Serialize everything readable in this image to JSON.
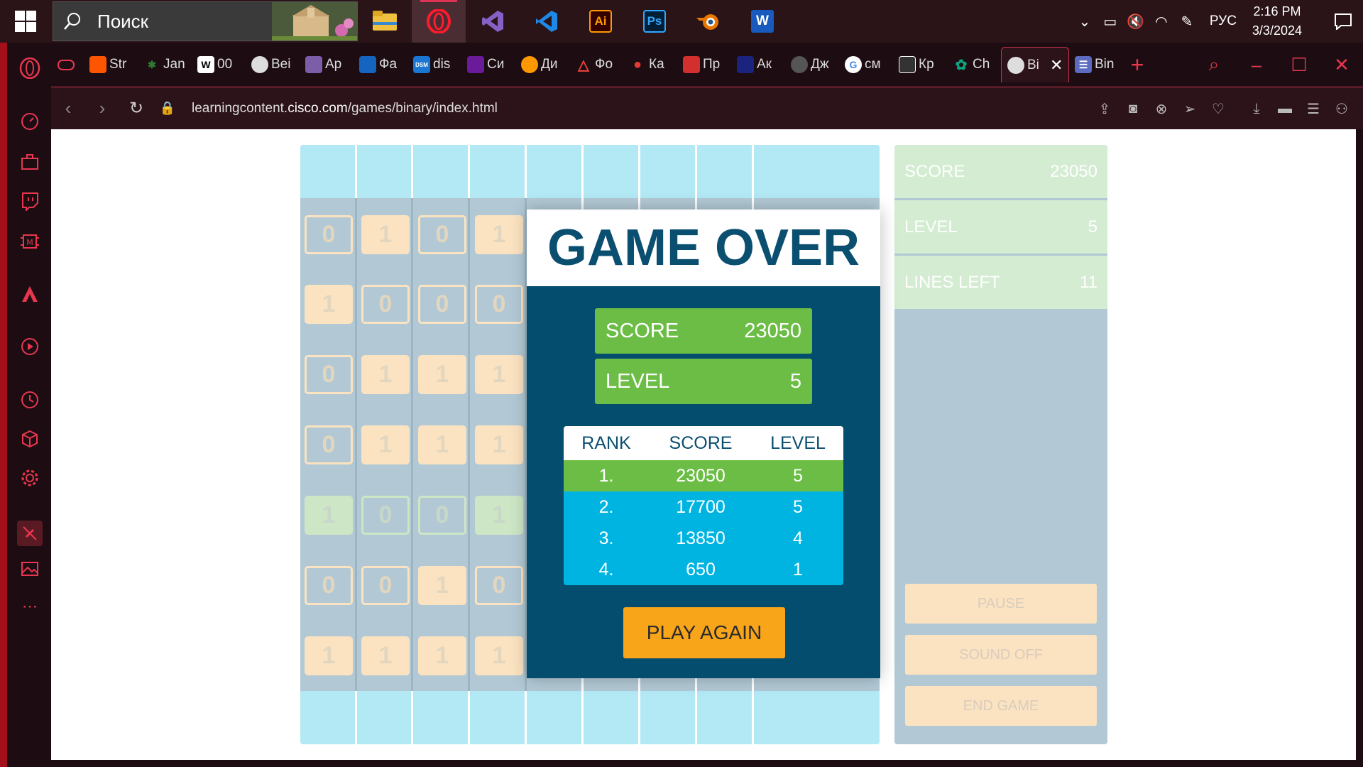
{
  "taskbar": {
    "search_placeholder": "Поиск",
    "apps": [
      "file-explorer",
      "opera",
      "visual-studio",
      "vscode",
      "illustrator",
      "photoshop",
      "blender",
      "word"
    ],
    "language": "РУС",
    "time": "2:16 PM",
    "date": "3/3/2024"
  },
  "tabs": [
    {
      "label": "Str",
      "color": "#ff5500"
    },
    {
      "label": "Jan",
      "color": "#2e7d32"
    },
    {
      "label": "00",
      "color": "#ffffff"
    },
    {
      "label": "Bei",
      "color": "#ffffff"
    },
    {
      "label": "Ap",
      "color": "#7b5ea7"
    },
    {
      "label": "Фа",
      "color": "#1565c0"
    },
    {
      "label": "dis",
      "color": "#1976d2"
    },
    {
      "label": "Си",
      "color": "#6a1b9a"
    },
    {
      "label": "Ди",
      "color": "#ff9800"
    },
    {
      "label": "Фо",
      "color": "#f44336"
    },
    {
      "label": "Ка",
      "color": "#e53935"
    },
    {
      "label": "Пр",
      "color": "#d32f2f"
    },
    {
      "label": "Ак",
      "color": "#1a237e"
    },
    {
      "label": "Дж",
      "color": "#555555"
    },
    {
      "label": "см",
      "color": "#4285f4"
    },
    {
      "label": "Кр",
      "color": "#333333"
    },
    {
      "label": "Ch",
      "color": "#10a37f"
    },
    {
      "label": "Bi",
      "color": "#ffffff"
    },
    {
      "label": "Bin",
      "color": "#5c6bc0"
    }
  ],
  "address": {
    "url_prefix": "learningcontent.",
    "url_domain": "cisco.com",
    "url_path": "/games/binary/index.html"
  },
  "game": {
    "rows": [
      [
        0,
        1,
        0,
        1
      ],
      [
        1,
        0,
        0,
        0
      ],
      [
        0,
        1,
        1,
        1
      ],
      [
        0,
        1,
        1,
        1
      ],
      [
        1,
        0,
        0,
        1
      ],
      [
        0,
        0,
        1,
        0
      ],
      [
        1,
        1,
        1,
        1
      ]
    ],
    "highlight_row": 4,
    "side": {
      "score_label": "SCORE",
      "score": "23050",
      "level_label": "LEVEL",
      "level": "5",
      "lines_label": "LINES LEFT",
      "lines": "11",
      "pause": "PAUSE",
      "sound": "SOUND OFF",
      "end": "END GAME"
    },
    "modal": {
      "title": "GAME OVER",
      "score_label": "SCORE",
      "score": "23050",
      "level_label": "LEVEL",
      "level": "5",
      "table_headers": [
        "RANK",
        "SCORE",
        "LEVEL"
      ],
      "table_rows": [
        [
          "1.",
          "23050",
          "5"
        ],
        [
          "2.",
          "17700",
          "5"
        ],
        [
          "3.",
          "13850",
          "4"
        ],
        [
          "4.",
          "650",
          "1"
        ]
      ],
      "play_again": "PLAY AGAIN"
    }
  },
  "colors": {
    "accent": "#e8364f",
    "board": "#b2c9d5",
    "band": "#b3e8f5",
    "modal": "#054d6e",
    "green": "#6cbd45",
    "cyan": "#00b4e2",
    "orange": "#f9a51a"
  }
}
